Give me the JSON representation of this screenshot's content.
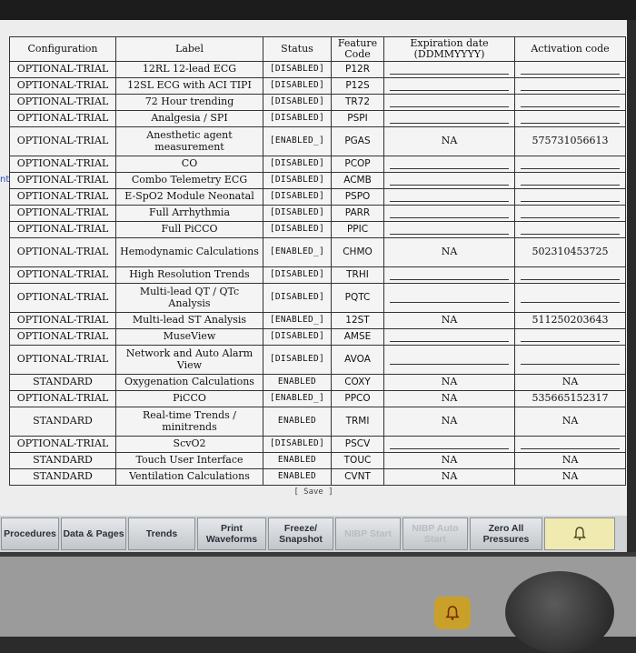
{
  "table": {
    "headers": [
      "Configuration",
      "Label",
      "Status",
      "Feature Code",
      "Expiration date (DDMMYYYY)",
      "Activation code"
    ],
    "rows": [
      {
        "config": "OPTIONAL-TRIAL",
        "label": "12RL 12-lead ECG",
        "status": "[DISABLED]",
        "code": "P12R",
        "exp": "",
        "act": ""
      },
      {
        "config": "OPTIONAL-TRIAL",
        "label": "12SL ECG with ACI TIPI",
        "status": "[DISABLED]",
        "code": "P12S",
        "exp": "",
        "act": ""
      },
      {
        "config": "OPTIONAL-TRIAL",
        "label": "72 Hour trending",
        "status": "[DISABLED]",
        "code": "TR72",
        "exp": "",
        "act": ""
      },
      {
        "config": "OPTIONAL-TRIAL",
        "label": "Analgesia / SPI",
        "status": "[DISABLED]",
        "code": "PSPI",
        "exp": "",
        "act": ""
      },
      {
        "config": "OPTIONAL-TRIAL",
        "label": "Anesthetic agent measurement",
        "status": "[ENABLED_]",
        "code": "PGAS",
        "exp": "NA",
        "act": "575731056613"
      },
      {
        "config": "OPTIONAL-TRIAL",
        "label": "CO",
        "status": "[DISABLED]",
        "code": "PCOP",
        "exp": "",
        "act": ""
      },
      {
        "config": "OPTIONAL-TRIAL",
        "label": "Combo Telemetry ECG",
        "status": "[DISABLED]",
        "code": "ACMB",
        "exp": "",
        "act": ""
      },
      {
        "config": "OPTIONAL-TRIAL",
        "label": "E-SpO2 Module Neonatal",
        "status": "[DISABLED]",
        "code": "PSPO",
        "exp": "",
        "act": ""
      },
      {
        "config": "OPTIONAL-TRIAL",
        "label": "Full Arrhythmia",
        "status": "[DISABLED]",
        "code": "PARR",
        "exp": "",
        "act": ""
      },
      {
        "config": "OPTIONAL-TRIAL",
        "label": "Full PiCCO",
        "status": "[DISABLED]",
        "code": "PPIC",
        "exp": "",
        "act": ""
      },
      {
        "config": "OPTIONAL-TRIAL",
        "label": "Hemodynamic Calculations",
        "status": "[ENABLED_]",
        "code": "CHMO",
        "exp": "NA",
        "act": "502310453725"
      },
      {
        "config": "OPTIONAL-TRIAL",
        "label": "High Resolution Trends",
        "status": "[DISABLED]",
        "code": "TRHI",
        "exp": "",
        "act": ""
      },
      {
        "config": "OPTIONAL-TRIAL",
        "label": "Multi-lead QT / QTc Analysis",
        "status": "[DISABLED]",
        "code": "PQTC",
        "exp": "",
        "act": ""
      },
      {
        "config": "OPTIONAL-TRIAL",
        "label": "Multi-lead ST Analysis",
        "status": "[ENABLED_]",
        "code": "12ST",
        "exp": "NA",
        "act": "511250203643"
      },
      {
        "config": "OPTIONAL-TRIAL",
        "label": "MuseView",
        "status": "[DISABLED]",
        "code": "AMSE",
        "exp": "",
        "act": ""
      },
      {
        "config": "OPTIONAL-TRIAL",
        "label": "Network and Auto Alarm View",
        "status": "[DISABLED]",
        "code": "AVOA",
        "exp": "",
        "act": ""
      },
      {
        "config": "STANDARD",
        "label": "Oxygenation Calculations",
        "status": "ENABLED",
        "code": "COXY",
        "exp": "NA",
        "act": "NA"
      },
      {
        "config": "OPTIONAL-TRIAL",
        "label": "PiCCO",
        "status": "[ENABLED_]",
        "code": "PPCO",
        "exp": "NA",
        "act": "535665152317"
      },
      {
        "config": "STANDARD",
        "label": "Real-time Trends / minitrends",
        "status": "ENABLED",
        "code": "TRMI",
        "exp": "NA",
        "act": "NA"
      },
      {
        "config": "OPTIONAL-TRIAL",
        "label": "ScvO2",
        "status": "[DISABLED]",
        "code": "PSCV",
        "exp": "",
        "act": ""
      },
      {
        "config": "STANDARD",
        "label": "Touch User Interface",
        "status": "ENABLED",
        "code": "TOUC",
        "exp": "NA",
        "act": "NA"
      },
      {
        "config": "STANDARD",
        "label": "Ventilation Calculations",
        "status": "ENABLED",
        "code": "CVNT",
        "exp": "NA",
        "act": "NA"
      }
    ]
  },
  "save_label": "[ Save ]",
  "left_edge_text": "nt",
  "buttons": [
    {
      "name": "procedures-button",
      "label": "Procedures",
      "disabled": false
    },
    {
      "name": "data-pages-button",
      "label": "Data & Pages",
      "disabled": false
    },
    {
      "name": "trends-button",
      "label": "Trends",
      "disabled": false
    },
    {
      "name": "print-waveforms-button",
      "label": "Print Waveforms",
      "disabled": false
    },
    {
      "name": "freeze-snapshot-button",
      "label": "Freeze/ Snapshot",
      "disabled": false
    },
    {
      "name": "nibp-start-button",
      "label": "NIBP Start",
      "disabled": true
    },
    {
      "name": "nibp-auto-start-button",
      "label": "NIBP Auto Start",
      "disabled": true
    },
    {
      "name": "zero-all-pressures-button",
      "label": "Zero All Pressures",
      "disabled": false
    }
  ],
  "alarm_icon": "alarm-bell-icon",
  "colors": {
    "screen_bg": "#ededee",
    "alarm_button": "#f1eab0",
    "led": "#c9a12a"
  }
}
